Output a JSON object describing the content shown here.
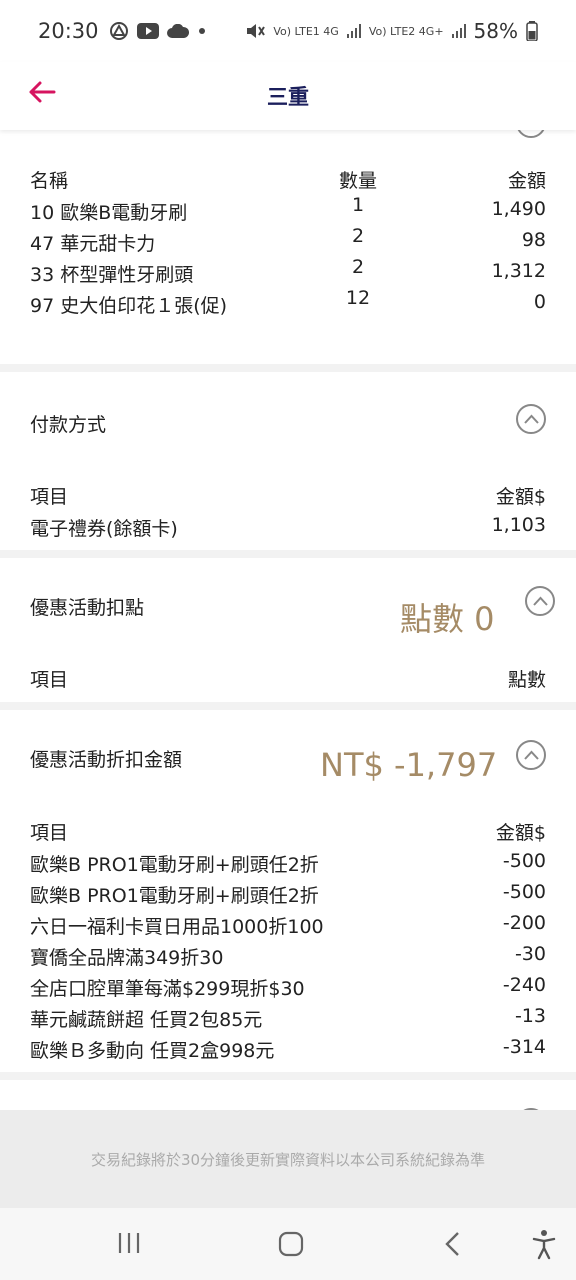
{
  "status": {
    "time": "20:30",
    "network1": "Vo) LTE1 4G",
    "network2": "Vo) LTE2 4G+",
    "battery": "58%"
  },
  "header": {
    "title": "三重"
  },
  "purchase": {
    "cols": {
      "name": "名稱",
      "qty": "數量",
      "amount": "金額"
    },
    "items": [
      {
        "name": "10 歐樂B電動牙刷",
        "qty": "1",
        "amount": "1,490"
      },
      {
        "name": "47 華元甜卡力",
        "qty": "2",
        "amount": "98"
      },
      {
        "name": "33 杯型彈性牙刷頭",
        "qty": "2",
        "amount": "1,312"
      },
      {
        "name": "97 史大伯印花１張(促)",
        "qty": "12",
        "amount": "0"
      }
    ]
  },
  "payment": {
    "title": "付款方式",
    "cols": {
      "item": "項目",
      "amount": "金額$"
    },
    "items": [
      {
        "name": "電子禮券(餘額卡)",
        "amount": "1,103"
      }
    ]
  },
  "points": {
    "title": "優惠活動扣點",
    "summary": "點數 0",
    "cols": {
      "item": "項目",
      "points": "點數"
    }
  },
  "discount": {
    "title": "優惠活動折扣金額",
    "summary": "NT$ -1,797",
    "cols": {
      "item": "項目",
      "amount": "金額$"
    },
    "items": [
      {
        "name": "歐樂B PRO1電動牙刷+刷頭任2折",
        "amount": "-500"
      },
      {
        "name": "歐樂B PRO1電動牙刷+刷頭任2折",
        "amount": "-500"
      },
      {
        "name": "六日一福利卡買日用品1000折100",
        "amount": "-200"
      },
      {
        "name": "寶僑全品牌滿349折30",
        "amount": "-30"
      },
      {
        "name": "全店口腔單筆每滿$299現折$30",
        "amount": "-240"
      },
      {
        "name": "華元鹹蔬餅超 任買2包85元",
        "amount": "-13"
      },
      {
        "name": "歐樂Ｂ多動向 任買2盒998元",
        "amount": "-314"
      }
    ]
  },
  "footer": {
    "note": "交易紀錄將於30分鐘後更新實際資料以本公司系統紀錄為準"
  },
  "colors": {
    "accent": "#d6145f",
    "title": "#1b1f5c",
    "gold": "#a58b66"
  },
  "icons": {
    "back": "arrow-left-icon",
    "collapse": "chevron-up-icon"
  }
}
